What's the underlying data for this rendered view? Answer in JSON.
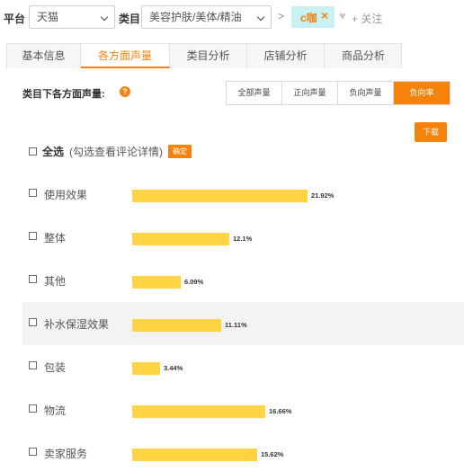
{
  "filters": {
    "platform_label": "平台",
    "platform_value": "天猫",
    "category_label": "类目",
    "category_value": "美容护肤/美体/精油",
    "breadcrumb_sep": ">",
    "chip_text": "c咖",
    "chip_close": "×",
    "heart_icon": "heart-icon",
    "follow_label": "+ 关注"
  },
  "tabs": [
    {
      "label": "基本信息",
      "active": false
    },
    {
      "label": "各方面声量",
      "active": true
    },
    {
      "label": "类目分析",
      "active": false
    },
    {
      "label": "店铺分析",
      "active": false
    },
    {
      "label": "商品分析",
      "active": false
    }
  ],
  "content": {
    "title": "类目下各方面声量:",
    "help_icon": "?",
    "segments": [
      {
        "label": "全部声量",
        "active": false
      },
      {
        "label": "正向声量",
        "active": false
      },
      {
        "label": "负向声量",
        "active": false
      },
      {
        "label": "负向率",
        "active": true
      }
    ],
    "download_label": "下载",
    "select_all_label": "全选",
    "select_all_hint": "(勾选查看评论详情)",
    "confirm_label": "确定"
  },
  "chart_data": {
    "type": "bar",
    "orientation": "horizontal",
    "categories": [
      "使用效果",
      "整体",
      "其他",
      "补水保湿效果",
      "包装",
      "物流",
      "卖家服务"
    ],
    "values": [
      21.92,
      12.1,
      6.09,
      11.11,
      3.44,
      16.66,
      15.62
    ],
    "value_labels": [
      "21.92%",
      "12.1%",
      "6.09%",
      "11.11%",
      "3.44%",
      "16.66%",
      "15.62%"
    ],
    "highlighted_row": 3,
    "bar_color": "#ffd344"
  },
  "colors": {
    "accent": "#f5820b",
    "chip_bg": "#c8f1f4",
    "bar": "#ffd344"
  }
}
